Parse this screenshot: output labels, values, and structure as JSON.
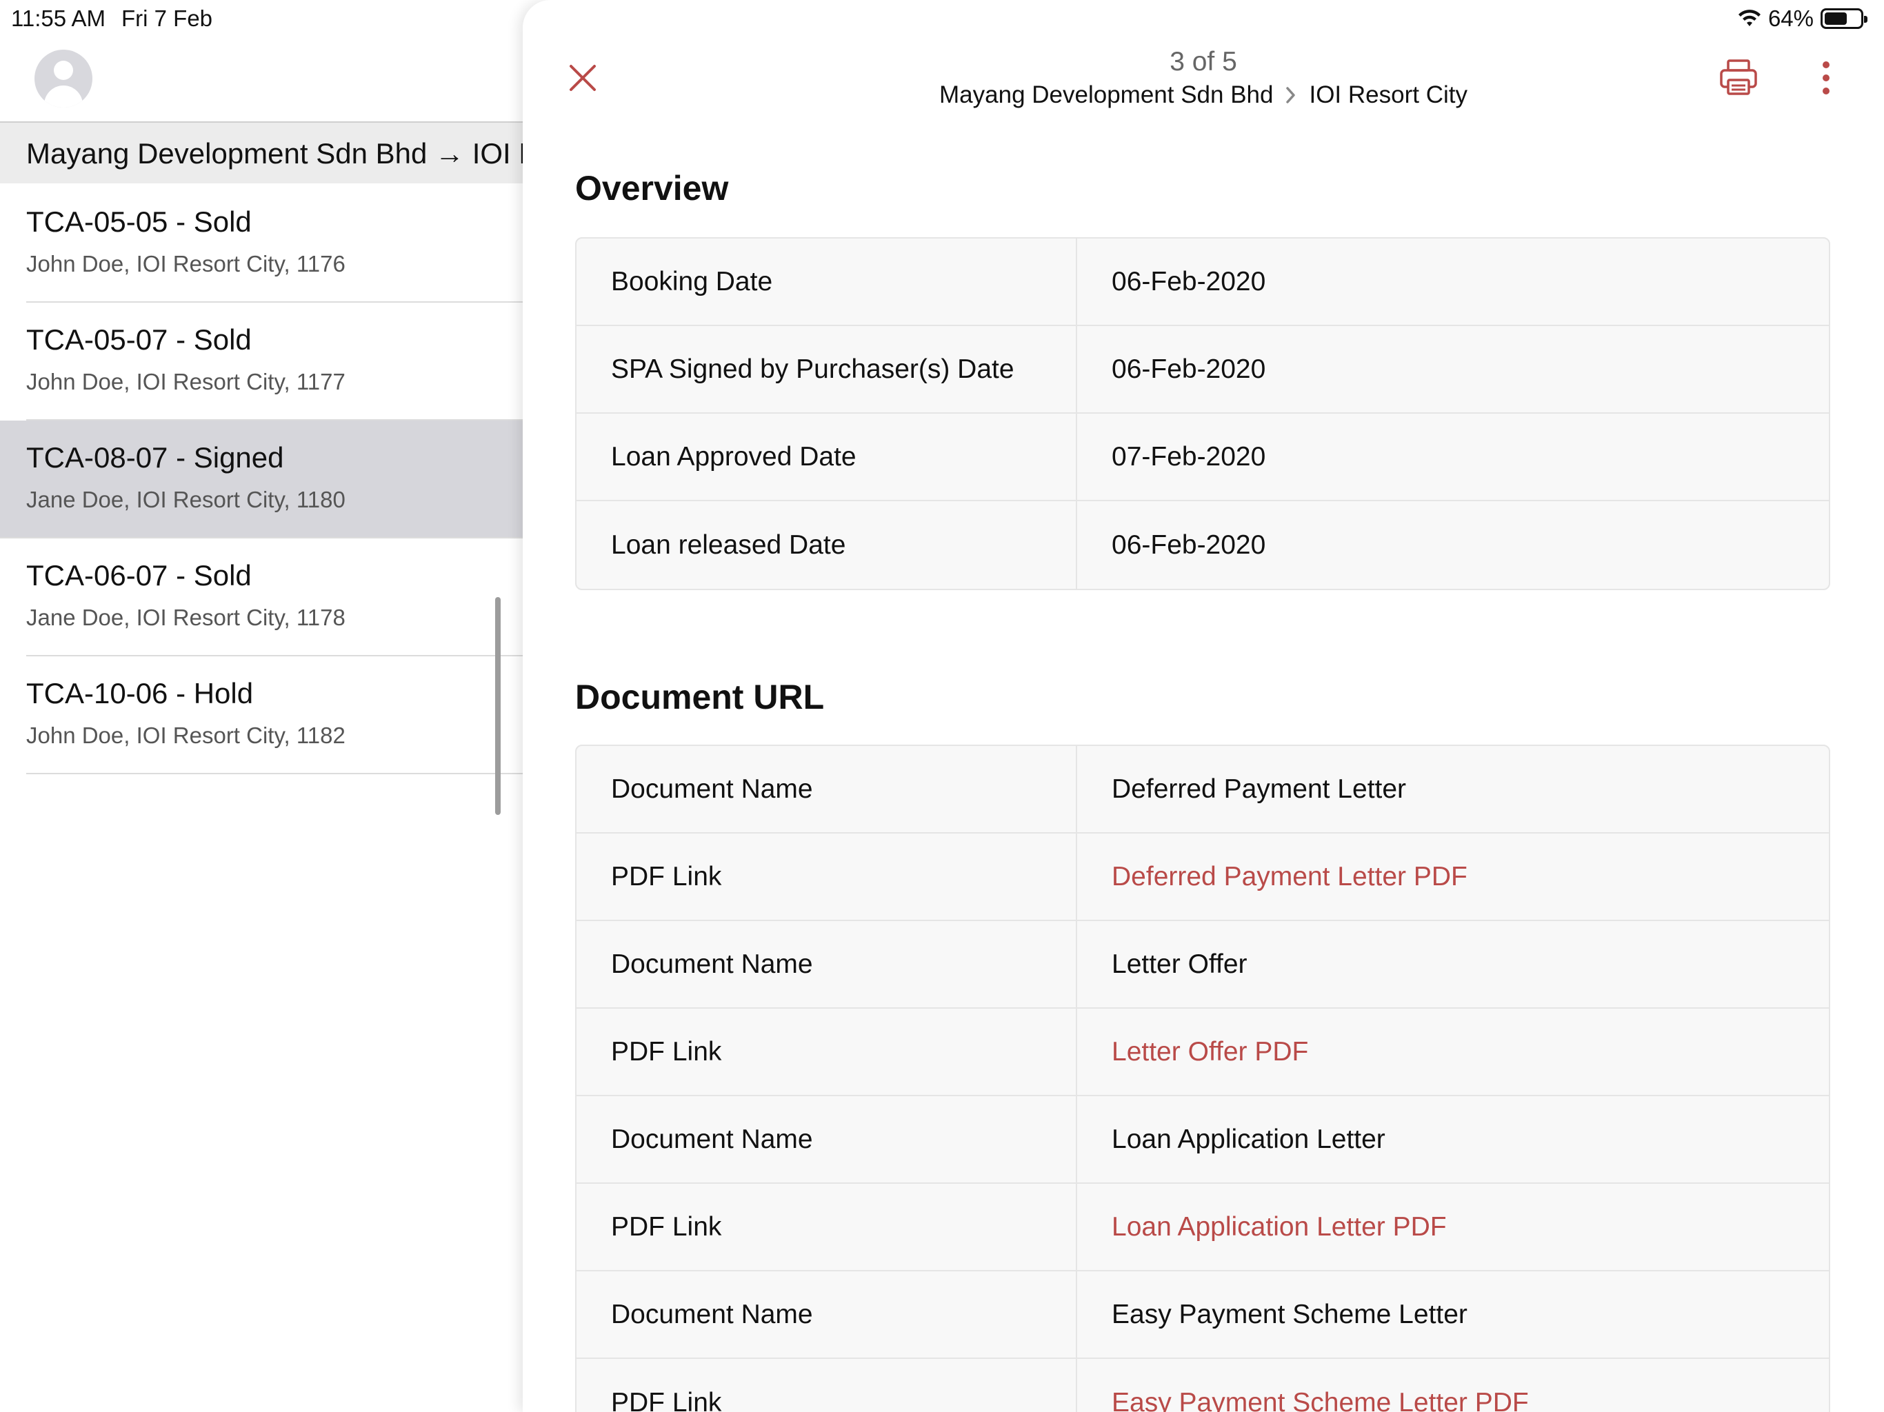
{
  "status_bar": {
    "time": "11:55 AM",
    "date": "Fri 7 Feb",
    "battery": "64%",
    "battery_level": 0.64
  },
  "sidebar": {
    "section_header": "Mayang Development Sdn Bhd → IOI Resort City",
    "items": [
      {
        "title": "TCA-05-05 - Sold",
        "subtitle": "John Doe, IOI Resort City, 1176"
      },
      {
        "title": "TCA-05-07 - Sold",
        "subtitle": "John Doe, IOI Resort City, 1177"
      },
      {
        "title": "TCA-08-07 - Signed",
        "subtitle": "Jane Doe, IOI Resort City, 1180"
      },
      {
        "title": "TCA-06-07 - Sold",
        "subtitle": "Jane Doe, IOI Resort City, 1178"
      },
      {
        "title": "TCA-10-06 - Hold",
        "subtitle": "John Doe, IOI Resort City, 1182"
      }
    ]
  },
  "detail": {
    "counter": "3 of 5",
    "breadcrumb": [
      "Mayang Development Sdn Bhd",
      "IOI Resort City"
    ],
    "accent_color": "#b94a48",
    "overview": {
      "title": "Overview",
      "rows": [
        {
          "label": "Booking Date",
          "value": "06-Feb-2020"
        },
        {
          "label": "SPA Signed by Purchaser(s) Date",
          "value": "06-Feb-2020"
        },
        {
          "label": "Loan Approved Date",
          "value": "07-Feb-2020"
        },
        {
          "label": "Loan released Date",
          "value": "06-Feb-2020"
        }
      ]
    },
    "documents": {
      "title": "Document URL",
      "rows": [
        {
          "label": "Document Name",
          "value": "Deferred Payment Letter"
        },
        {
          "label": "PDF Link",
          "value": "Deferred Payment Letter PDF"
        },
        {
          "label": "Document Name",
          "value": "Letter Offer"
        },
        {
          "label": "PDF Link",
          "value": "Letter Offer PDF"
        },
        {
          "label": "Document Name",
          "value": "Loan Application Letter"
        },
        {
          "label": "PDF Link",
          "value": "Loan Application Letter PDF"
        },
        {
          "label": "Document Name",
          "value": "Easy Payment Scheme Letter"
        },
        {
          "label": "PDF Link",
          "value": "Easy Payment Scheme Letter PDF"
        }
      ]
    }
  }
}
